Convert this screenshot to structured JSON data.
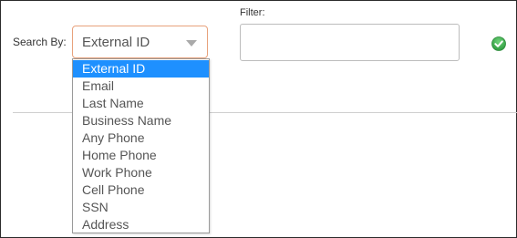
{
  "search": {
    "label": "Search By:",
    "selected": "External ID",
    "options": [
      "External ID",
      "Email",
      "Last Name",
      "Business Name",
      "Any Phone",
      "Home Phone",
      "Work Phone",
      "Cell Phone",
      "SSN",
      "Address"
    ],
    "selected_index": 0
  },
  "filter": {
    "label": "Filter:",
    "value": ""
  },
  "icons": {
    "submit": "check-circle-icon",
    "dropdown": "caret-down-icon"
  },
  "colors": {
    "select_border": "#e8a27c",
    "highlight": "#1e90ff",
    "check_green": "#3cae4f"
  }
}
